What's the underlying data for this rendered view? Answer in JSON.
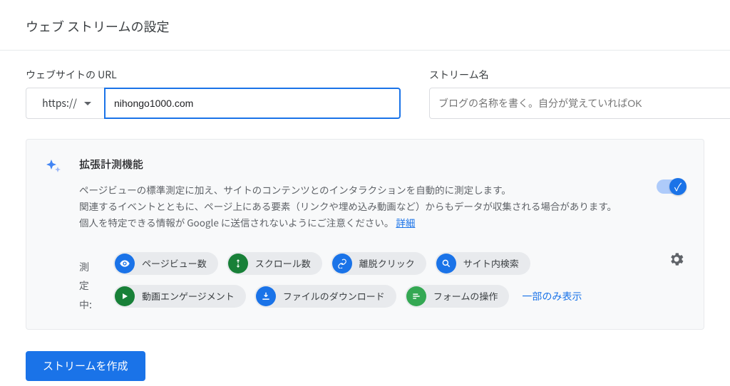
{
  "page_title": "ウェブ ストリームの設定",
  "url": {
    "label": "ウェブサイトの URL",
    "protocol": "https://",
    "value": "nihongo1000.com"
  },
  "stream_name": {
    "label": "ストリーム名",
    "placeholder": "ブログの名称を書く。自分が覚えていればOK"
  },
  "enhanced": {
    "title": "拡張計測機能",
    "desc_line1": "ページビューの標準測定に加え、サイトのコンテンツとのインタラクションを自動的に測定します。",
    "desc_line2": "関連するイベントとともに、ページ上にある要素（リンクや埋め込み動画など）からもデータが収集される場合があります。個人を特定できる情報が Google に送信されないようにご注意ください。",
    "learn_more": "詳細",
    "toggle_on": true
  },
  "measuring_label": "測定中:",
  "chips": [
    {
      "icon": "eye",
      "color": "blue",
      "label": "ページビュー数"
    },
    {
      "icon": "scroll",
      "color": "green",
      "label": "スクロール数"
    },
    {
      "icon": "link",
      "color": "blue",
      "label": "離脱クリック"
    },
    {
      "icon": "search",
      "color": "blue",
      "label": "サイト内検索"
    },
    {
      "icon": "play",
      "color": "green",
      "label": "動画エンゲージメント"
    },
    {
      "icon": "download",
      "color": "blue",
      "label": "ファイルのダウンロード"
    },
    {
      "icon": "form",
      "color": "green2",
      "label": "フォームの操作"
    }
  ],
  "show_less": "一部のみ表示",
  "create_button": "ストリームを作成"
}
